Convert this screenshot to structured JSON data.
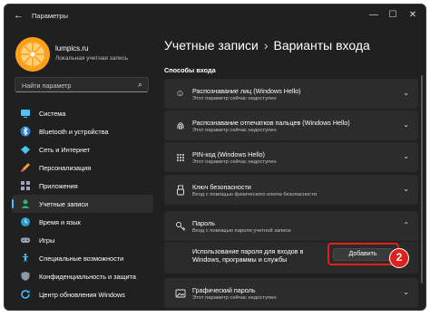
{
  "window": {
    "app_title": "Параметры",
    "controls": {
      "minimize": "—",
      "maximize": "☐",
      "close": "✕"
    }
  },
  "user": {
    "name": "lumpics.ru",
    "account_type": "Локальная учетная запись"
  },
  "search": {
    "placeholder": "Найти параметр"
  },
  "sidebar": {
    "items": [
      {
        "label": "Система",
        "icon": "monitor-icon"
      },
      {
        "label": "Bluetooth и устройства",
        "icon": "bluetooth-icon"
      },
      {
        "label": "Сеть и Интернет",
        "icon": "wifi-icon"
      },
      {
        "label": "Персонализация",
        "icon": "brush-icon"
      },
      {
        "label": "Приложения",
        "icon": "apps-icon"
      },
      {
        "label": "Учетные записи",
        "icon": "person-icon",
        "active": true
      },
      {
        "label": "Время и язык",
        "icon": "globe-clock-icon"
      },
      {
        "label": "Игры",
        "icon": "gamepad-icon"
      },
      {
        "label": "Специальные возможности",
        "icon": "accessibility-icon"
      },
      {
        "label": "Конфиденциальность и защита",
        "icon": "shield-icon"
      },
      {
        "label": "Центр обновления Windows",
        "icon": "update-icon"
      }
    ]
  },
  "breadcrumb": {
    "parent": "Учетные записи",
    "separator": "›",
    "current": "Варианты входа"
  },
  "section": {
    "title": "Способы входа"
  },
  "cards": [
    {
      "title": "Распознавание лиц (Windows Hello)",
      "subtitle": "Этот параметр сейчас недоступен",
      "icon": "face-icon"
    },
    {
      "title": "Распознавание отпечатков пальцев (Windows Hello)",
      "subtitle": "Этот параметр сейчас недоступен",
      "icon": "fingerprint-icon"
    },
    {
      "title": "PIN-код (Windows Hello)",
      "subtitle": "Этот параметр сейчас недоступен",
      "icon": "pin-grid-icon"
    },
    {
      "title": "Ключ безопасности",
      "subtitle": "Вход с помощью физического ключа безопасности",
      "icon": "usb-key-icon"
    },
    {
      "title": "Пароль",
      "subtitle": "Вход с помощью пароля учетной записи",
      "icon": "key-icon",
      "expanded": true
    },
    {
      "title": "Графический пароль",
      "subtitle": "Этот параметр сейчас недоступен",
      "icon": "picture-icon"
    }
  ],
  "password_panel": {
    "description": "Использование пароля для входов в Windows, программы и службы",
    "add_button": "Добавить",
    "step_number": "2"
  },
  "colors": {
    "accent": "#4cc2ff",
    "highlight": "#e0201a",
    "avatar": "#ff9f1a"
  }
}
